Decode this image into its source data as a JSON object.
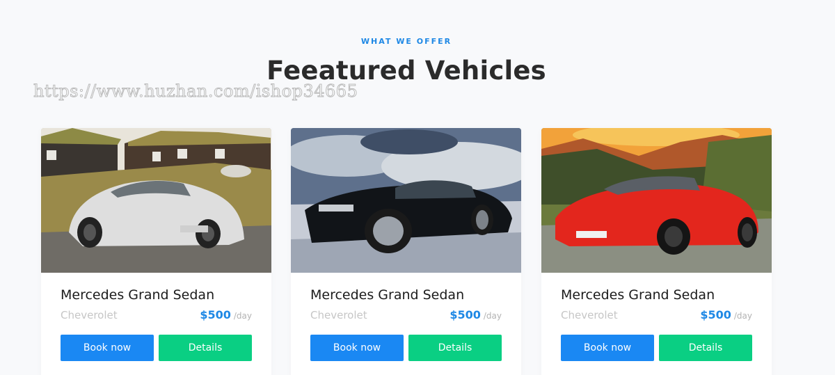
{
  "section": {
    "eyebrow": "WHAT WE OFFER",
    "title": "Feeatured Vehicles",
    "watermark": "https://www.huzhan.com/ishop34665"
  },
  "colors": {
    "accent": "#1a88f3",
    "details": "#0acf83",
    "price": "#1e88e5"
  },
  "cars": [
    {
      "title": "Mercedes Grand Sedan",
      "make": "Cheverolet",
      "price": "$500",
      "per": "/day",
      "book_label": "Book now",
      "details_label": "Details",
      "image": "white sports car parked by wooden houses"
    },
    {
      "title": "Mercedes Grand Sedan",
      "make": "Cheverolet",
      "price": "$500",
      "per": "/day",
      "book_label": "Book now",
      "details_label": "Details",
      "image": "black muscle car on snowy ground under cloudy sky"
    },
    {
      "title": "Mercedes Grand Sedan",
      "make": "Cheverolet",
      "price": "$500",
      "per": "/day",
      "book_label": "Book now",
      "details_label": "Details",
      "image": "red convertible roadster with mountain sunset"
    }
  ]
}
